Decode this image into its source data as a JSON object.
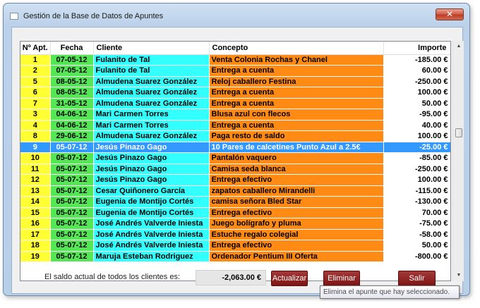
{
  "window": {
    "title": "Gestión de la Base de Datos de Apuntes",
    "close_label": "✕"
  },
  "table": {
    "columns": [
      "Nº Apt.",
      "Fecha",
      "Cliente",
      "Concepto",
      "Importe"
    ],
    "selected_index": 8,
    "rows": [
      [
        "1",
        "07-05-12",
        "Fulanito de Tal",
        "Venta Colonia Rochas y Chanel",
        "-185.00 €"
      ],
      [
        "2",
        "07-05-12",
        "Fulanito de Tal",
        "Entrega a cuenta",
        "60.00 €"
      ],
      [
        "5",
        "08-05-12",
        "Almudena Suarez González",
        "Reloj caballero Festina",
        "-250.00 €"
      ],
      [
        "6",
        "08-05-12",
        "Almudena Suarez González",
        "Entrega a cuenta",
        "100.00 €"
      ],
      [
        "7",
        "31-05-12",
        "Almudena Suarez González",
        "Entrega a cuenta",
        "50.00 €"
      ],
      [
        "3",
        "04-06-12",
        "Mari Carmen Torres",
        "Blusa azul con flecos",
        "-95.00 €"
      ],
      [
        "4",
        "04-06-12",
        "Mari Carmen Torres",
        "Entrega a cuenta",
        "40.00 €"
      ],
      [
        "8",
        "29-06-12",
        "Almudena Suarez González",
        "Paga resto de saldo",
        "100.00 €"
      ],
      [
        "9",
        "05-07-12",
        "Jesús Pinazo Gago",
        "10 Pares de calcetines Punto Azul a 2.5€",
        "-25.00 €"
      ],
      [
        "10",
        "05-07-12",
        "Jesús Pinazo Gago",
        "Pantalón vaquero",
        "-85.00 €"
      ],
      [
        "11",
        "05-07-12",
        "Jesús Pinazo Gago",
        "Camisa seda blanca",
        "-250.00 €"
      ],
      [
        "12",
        "05-07-12",
        "Jesús Pinazo Gago",
        "Entrega efectivo",
        "100.00 €"
      ],
      [
        "13",
        "05-07-12",
        "Cesar Quiñonero García",
        "zapatos caballero Mirandelli",
        "-115.00 €"
      ],
      [
        "14",
        "05-07-12",
        "Eugenia de Montijo Cortés",
        "camisa señora Bled Star",
        "-130.00 €"
      ],
      [
        "15",
        "05-07-12",
        "Eugenia de Montijo Cortés",
        "Entrega efectivo",
        "70.00 €"
      ],
      [
        "16",
        "05-07-12",
        "José Andrés Valverde Iniesta",
        "Juego bolígrafo y pluma",
        "-75.00 €"
      ],
      [
        "17",
        "05-07-12",
        "José Andrés Valverde Iniesta",
        "Estuche regalo colegial",
        "-58.00 €"
      ],
      [
        "18",
        "05-07-12",
        "José Andrés Valverde Iniesta",
        "Entrega efectivo",
        "50.00 €"
      ],
      [
        "19",
        "05-07-12",
        "Maruja Esteban Rodriguez",
        "Ordenador Pentium III Oferta",
        "-800.00 €"
      ]
    ]
  },
  "footer": {
    "saldo_label": "El saldo actual de todos los clientes es:",
    "saldo_value": "-2,063.00 €",
    "btn_actualizar": "Actualizar",
    "btn_eliminar": "Eliminar",
    "btn_salir": "Salir"
  },
  "tooltip": "Elimina el apunte que hay seleccionado.",
  "colors": {
    "num_col": "#ffff33",
    "date_col": "#55e655",
    "client_col": "#33ffff",
    "concept_col": "#ff8a14",
    "selection": "#3399ff",
    "button": "#8f2020"
  }
}
